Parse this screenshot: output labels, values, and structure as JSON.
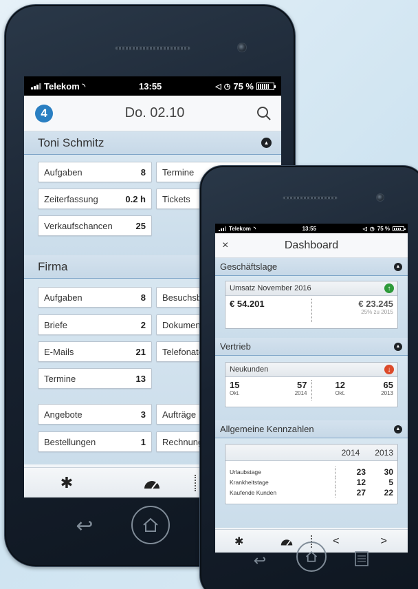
{
  "status_back": {
    "carrier": "Telekom",
    "time": "13:55",
    "battery": "75 %"
  },
  "status_front": {
    "carrier": "Telekom",
    "time": "13:55",
    "battery": "75 %"
  },
  "back": {
    "logo_text": "4",
    "header_date": "Do. 02.10",
    "section1": {
      "title": "Toni Schmitz",
      "tiles": [
        {
          "label": "Aufgaben",
          "value": "8"
        },
        {
          "label": "Termine",
          "value": ""
        },
        {
          "label": "Zeiterfassung",
          "value": "0.2 h"
        },
        {
          "label": "Tickets",
          "value": ""
        },
        {
          "label": "Verkaufschancen",
          "value": "25"
        }
      ]
    },
    "section2": {
      "title": "Firma",
      "tiles": [
        {
          "label": "Aufgaben",
          "value": "8"
        },
        {
          "label": "Besuchsb",
          "value": ""
        },
        {
          "label": "Briefe",
          "value": "2"
        },
        {
          "label": "Dokumen",
          "value": ""
        },
        {
          "label": "E-Mails",
          "value": "21"
        },
        {
          "label": "Telefonate",
          "value": ""
        },
        {
          "label": "Termine",
          "value": "13"
        },
        {
          "label": "Angebote",
          "value": "3"
        },
        {
          "label": "Aufträge",
          "value": ""
        },
        {
          "label": "Bestellungen",
          "value": "1"
        },
        {
          "label": "Rechnung",
          "value": ""
        }
      ]
    },
    "toolbar": {
      "back_arrow": "<"
    }
  },
  "front": {
    "close": "×",
    "title": "Dashboard",
    "geschaeftslage": {
      "title": "Geschäftslage",
      "card_title": "Umsatz November 2016",
      "current_value": "€ 54.201",
      "compare_value": "€ 23.245",
      "compare_note": "25% zu 2015"
    },
    "vertrieb": {
      "title": "Vertrieb",
      "card_title": "Neukunden",
      "left": [
        {
          "value": "15",
          "label": "Okt."
        },
        {
          "value": "57",
          "label": "2014"
        }
      ],
      "right": [
        {
          "value": "12",
          "label": "Okt."
        },
        {
          "value": "65",
          "label": "2013"
        }
      ]
    },
    "kennzahlen": {
      "title": "Allgemeine Kennzahlen",
      "years": [
        "2014",
        "2013"
      ],
      "rows": [
        {
          "label": "Urlaubstage",
          "v1": "23",
          "v2": "30"
        },
        {
          "label": "Krankheitstage",
          "v1": "12",
          "v2": "5"
        },
        {
          "label": "Kaufende Kunden",
          "v1": "27",
          "v2": "22"
        }
      ]
    },
    "toolbar": {
      "back_arrow": "<",
      "forward_arrow": ">"
    }
  },
  "colors": {
    "accent": "#2a7fc2",
    "up": "#2e9a3a",
    "down": "#dc4a2a",
    "section_bg": "#c6d8e7"
  }
}
